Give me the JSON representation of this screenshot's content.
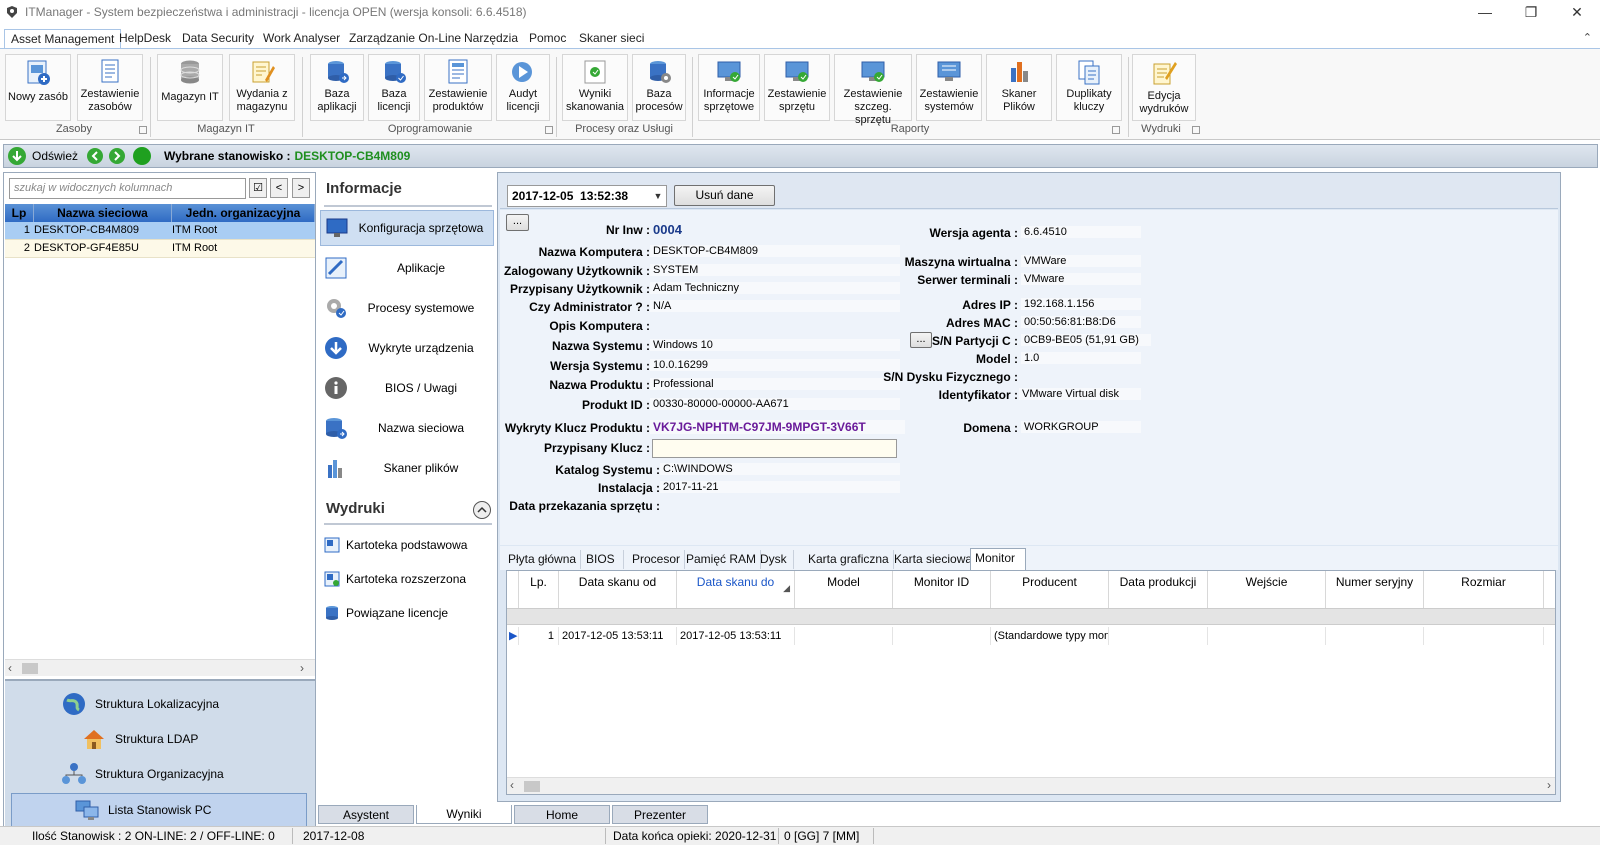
{
  "window": {
    "title": "ITManager - System bezpieczeństwa i administracji - licencja OPEN (wersja konsoli: 6.6.4518)"
  },
  "menu": {
    "tabs": [
      "Asset Management",
      "HelpDesk",
      "Data Security",
      "Work Analyser",
      "Zarządzanie On-Line",
      "Narzędzia",
      "Pomoc",
      "Skaner sieci"
    ]
  },
  "ribbon": {
    "buttons": [
      {
        "label1": "Nowy zasób",
        "label2": "",
        "icon": "new-asset-icon"
      },
      {
        "label1": "Zestawienie",
        "label2": "zasobów",
        "icon": "asset-report-icon"
      },
      {
        "label1": "Magazyn IT",
        "label2": "",
        "icon": "database-icon"
      },
      {
        "label1": "Wydania z",
        "label2": "magazynu",
        "icon": "release-icon"
      },
      {
        "label1": "Baza",
        "label2": "aplikacji",
        "icon": "app-database-icon"
      },
      {
        "label1": "Baza",
        "label2": "licencji",
        "icon": "license-database-icon"
      },
      {
        "label1": "Zestawienie",
        "label2": "produktów",
        "icon": "product-report-icon"
      },
      {
        "label1": "Audyt",
        "label2": "licencji",
        "icon": "audit-icon"
      },
      {
        "label1": "Wyniki",
        "label2": "skanowania",
        "icon": "scan-results-icon"
      },
      {
        "label1": "Baza",
        "label2": "procesów",
        "icon": "process-database-icon"
      },
      {
        "label1": "Informacje",
        "label2": "sprzętowe",
        "icon": "hardware-info-icon"
      },
      {
        "label1": "Zestawienie",
        "label2": "sprzętu",
        "icon": "hardware-report-icon"
      },
      {
        "label1": "Zestawienie",
        "label2": "szczeg. sprzętu",
        "icon": "hardware-detail-icon"
      },
      {
        "label1": "Zestawienie",
        "label2": "systemów",
        "icon": "systems-report-icon"
      },
      {
        "label1": "Skaner",
        "label2": "Plików",
        "icon": "file-scanner-icon"
      },
      {
        "label1": "Duplikaty",
        "label2": "kluczy",
        "icon": "duplicate-keys-icon"
      },
      {
        "label1": "Edycja",
        "label2": "wydruków",
        "icon": "edit-prints-icon"
      }
    ],
    "groups": [
      "Zasoby",
      "Magazyn IT",
      "Oprogramowanie",
      "Procesy oraz Usługi",
      "Raporty",
      "Wydruki"
    ]
  },
  "selbar": {
    "refresh": "Odśwież",
    "selected_label": "Wybrane stanowisko :",
    "selected_value": "DESKTOP-CB4M809"
  },
  "left": {
    "search_placeholder": "szukaj w widocznych kolumnach",
    "prev": "<",
    "next": ">",
    "columns": [
      "Lp",
      "Nazwa sieciowa",
      "Jedn. organizacyjna"
    ],
    "rows": [
      {
        "lp": "1",
        "name": "DESKTOP-CB4M809",
        "org": "ITM Root"
      },
      {
        "lp": "2",
        "name": "DESKTOP-GF4E85U",
        "org": "ITM Root"
      }
    ],
    "nav": [
      "Struktura Lokalizacyjna",
      "Struktura LDAP",
      "Struktura Organizacyjna",
      "Lista Stanowisk PC"
    ]
  },
  "info": {
    "title": "Informacje",
    "items": [
      "Konfiguracja sprzętowa",
      "Aplikacje",
      "Procesy systemowe",
      "Wykryte urządzenia",
      "BIOS / Uwagi",
      "Nazwa sieciowa",
      "Skaner plików"
    ],
    "prints_title": "Wydruki",
    "prints": [
      "Kartoteka podstawowa",
      "Kartoteka rozszerzona",
      "Powiązane licencje"
    ]
  },
  "main": {
    "date": "2017-12-05  13:52:38",
    "delete_button": "Usuń dane",
    "dots": "...",
    "fields_left": [
      {
        "label": "Nr Inw :",
        "value": "0004"
      },
      {
        "label": "Nazwa Komputera :",
        "value": "DESKTOP-CB4M809"
      },
      {
        "label": "Zalogowany Użytkownik :",
        "value": "SYSTEM"
      },
      {
        "label": "Przypisany Użytkownik :",
        "value": "Adam Techniczny"
      },
      {
        "label": "Czy Administrator ? :",
        "value": "N/A"
      },
      {
        "label": "Opis Komputera :",
        "value": ""
      },
      {
        "label": "Nazwa Systemu :",
        "value": "Windows 10"
      },
      {
        "label": "Wersja Systemu :",
        "value": "10.0.16299"
      },
      {
        "label": "Nazwa Produktu :",
        "value": "Professional"
      },
      {
        "label": "Produkt ID :",
        "value": "00330-80000-00000-AA671"
      },
      {
        "label": "Wykryty Klucz Produktu :",
        "value": "VK7JG-NPHTM-C97JM-9MPGT-3V66T"
      },
      {
        "label": "Przypisany Klucz :",
        "value": ""
      },
      {
        "label": "Katalog Systemu :",
        "value": "C:\\WINDOWS"
      },
      {
        "label": "Instalacja :",
        "value": "2017-11-21"
      },
      {
        "label": "Data przekazania sprzętu :",
        "value": ""
      }
    ],
    "fields_right": [
      {
        "label": "Wersja agenta :",
        "value": "6.6.4510"
      },
      {
        "label": "Maszyna wirtualna :",
        "value": "VMWare"
      },
      {
        "label": "Serwer terminali :",
        "value": "VMware"
      },
      {
        "label": "Adres IP :",
        "value": "192.168.1.156"
      },
      {
        "label": "Adres MAC :",
        "value": "00:50:56:81:B8:D6"
      },
      {
        "label": "S/N Partycji C :",
        "value": "0CB9-BE05 (51,91 GB)"
      },
      {
        "label": "Model :",
        "value": "1.0"
      },
      {
        "label": "S/N Dysku Fizycznego :",
        "value": ""
      },
      {
        "label": "Identyfikator :",
        "value": "VMware Virtual disk"
      },
      {
        "label": "Domena :",
        "value": "WORKGROUP"
      }
    ],
    "subtabs": [
      "Płyta główna",
      "BIOS",
      "Procesor",
      "Pamięć RAM",
      "Dysk",
      "Karta graficzna",
      "Karta sieciowa",
      "Monitor"
    ],
    "grid": {
      "columns": [
        "Lp.",
        "Data skanu od",
        "Data skanu do",
        "Model",
        "Monitor ID",
        "Producent",
        "Data produkcji",
        "Wejście",
        "Numer seryjny",
        "Rozmiar"
      ],
      "rows": [
        {
          "lp": "1",
          "from": "2017-12-05 13:53:11",
          "to": "2017-12-05 13:53:11",
          "model": "",
          "monitor_id": "",
          "producer": "(Standardowe typy mon",
          "prod_date": "",
          "input": "",
          "serial": "",
          "size": ""
        }
      ]
    }
  },
  "bottom_tabs": [
    "Asystent",
    "Wyniki",
    "Home",
    "Prezenter"
  ],
  "status": {
    "count": "Ilość Stanowisk : 2  ON-LINE: 2 / OFF-LINE: 0",
    "date": "2017-12-08",
    "care_end": "Data końca opieki: 2020-12-31",
    "remaining": "0 [GG]  7 [MM]"
  },
  "colors": {
    "accent": "#2f6bc4",
    "online_green": "#1f8f1f",
    "key_purple": "#6a1b9a"
  }
}
